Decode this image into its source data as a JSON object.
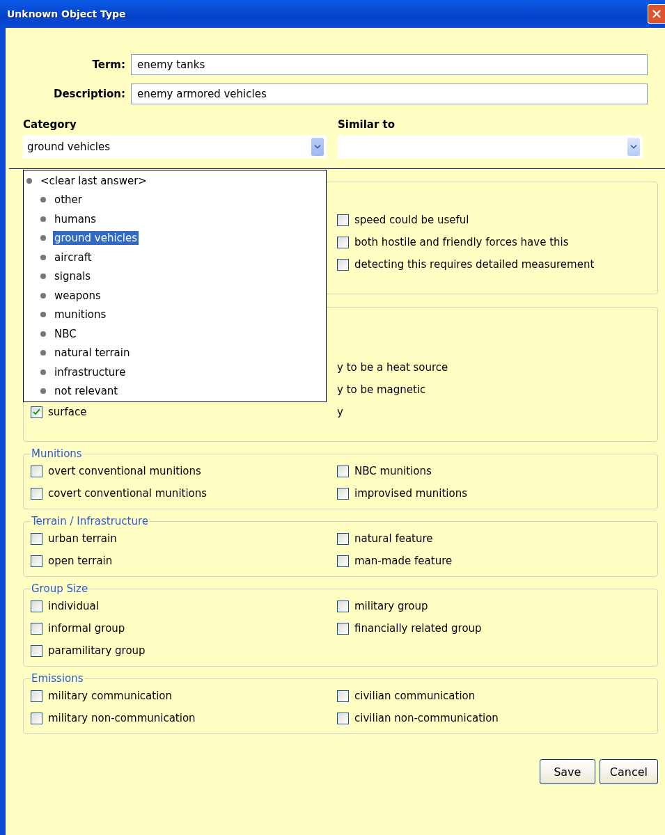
{
  "window": {
    "title": "Unknown Object Type"
  },
  "fields": [
    {
      "label": "Term:",
      "value": "enemy tanks"
    },
    {
      "label": "Description:",
      "value": "enemy armored vehicles"
    }
  ],
  "category": {
    "label": "Category",
    "value": "ground vehicles",
    "expanded": true,
    "options": [
      {
        "label": "<clear last answer>",
        "kind": "clear",
        "selected": false
      },
      {
        "label": "other",
        "kind": "option",
        "selected": false
      },
      {
        "label": "humans",
        "kind": "option",
        "selected": false
      },
      {
        "label": "ground vehicles",
        "kind": "option",
        "selected": true
      },
      {
        "label": "aircraft",
        "kind": "option",
        "selected": false
      },
      {
        "label": "signals",
        "kind": "option",
        "selected": false
      },
      {
        "label": "weapons",
        "kind": "option",
        "selected": false
      },
      {
        "label": "munitions",
        "kind": "option",
        "selected": false
      },
      {
        "label": "NBC",
        "kind": "option",
        "selected": false
      },
      {
        "label": "natural terrain",
        "kind": "option",
        "selected": false
      },
      {
        "label": "infrastructure",
        "kind": "option",
        "selected": false
      },
      {
        "label": "not relevant",
        "kind": "option",
        "selected": false
      }
    ]
  },
  "similar_to": {
    "label": "Similar to"
  },
  "groups": [
    {
      "columns": [
        {
          "items": [
            {
              "label": "speed could be useful",
              "checked": false
            },
            {
              "label": "both hostile and friendly forces have this",
              "checked": false
            },
            {
              "label": "detecting this requires detailed measurement",
              "checked": false
            }
          ]
        }
      ]
    },
    {
      "columns": [
        {
          "items": [
            {
              "label": "surface",
              "checked": true
            }
          ]
        },
        {
          "items": [
            {
              "label": "y to be a heat source"
            },
            {
              "label": "y to be magnetic"
            },
            {
              "label": "y"
            }
          ]
        }
      ]
    },
    {
      "legend": "Munitions",
      "columns": [
        {
          "items": [
            {
              "label": "overt conventional munitions",
              "checked": false
            },
            {
              "label": "covert conventional munitions",
              "checked": false
            }
          ]
        },
        {
          "items": [
            {
              "label": "NBC munitions",
              "checked": false
            },
            {
              "label": "improvised munitions",
              "checked": false
            }
          ]
        }
      ]
    },
    {
      "legend": "Terrain / Infrastructure",
      "columns": [
        {
          "items": [
            {
              "label": "urban terrain",
              "checked": false
            },
            {
              "label": "open terrain",
              "checked": false
            }
          ]
        },
        {
          "items": [
            {
              "label": "natural feature",
              "checked": false
            },
            {
              "label": "man-made feature",
              "checked": false
            }
          ]
        }
      ]
    },
    {
      "legend": "Group Size",
      "columns": [
        {
          "items": [
            {
              "label": "individual",
              "checked": false
            },
            {
              "label": "informal group",
              "checked": false
            },
            {
              "label": "paramilitary group",
              "checked": false
            }
          ]
        },
        {
          "items": [
            {
              "label": "military group",
              "checked": false
            },
            {
              "label": "financially related group",
              "checked": false
            }
          ]
        }
      ]
    },
    {
      "legend": "Emissions",
      "columns": [
        {
          "items": [
            {
              "label": "military communication",
              "checked": false
            },
            {
              "label": "military non-communication",
              "checked": false
            }
          ]
        },
        {
          "items": [
            {
              "label": "civilian communication",
              "checked": false
            },
            {
              "label": "civilian non-communication",
              "checked": false
            }
          ]
        }
      ]
    }
  ],
  "buttons": [
    "Save",
    "Cancel"
  ]
}
